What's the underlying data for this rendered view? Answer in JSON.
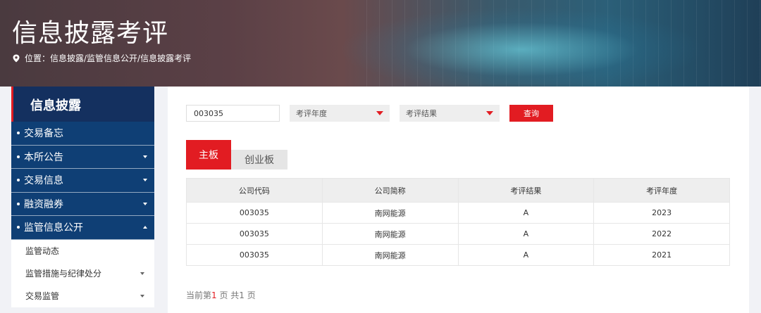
{
  "banner": {
    "title": "信息披露考评",
    "crumb": "位置：信息披露/监管信息公开/信息披露考评"
  },
  "sidebar": {
    "heading": "信息披露",
    "items": [
      {
        "label": "交易备忘"
      },
      {
        "label": "本所公告"
      },
      {
        "label": "交易信息"
      },
      {
        "label": "融资融券"
      },
      {
        "label": "监管信息公开"
      }
    ],
    "subitems": [
      {
        "label": "监管动态"
      },
      {
        "label": "监管措施与纪律处分"
      },
      {
        "label": "交易监管"
      }
    ]
  },
  "filters": {
    "code_value": "003035",
    "year_placeholder": "考评年度",
    "result_placeholder": "考评结果",
    "query_label": "查询"
  },
  "tabs": [
    {
      "label": "主板",
      "active": true
    },
    {
      "label": "创业板",
      "active": false
    }
  ],
  "table": {
    "headers": [
      "公司代码",
      "公司简称",
      "考评结果",
      "考评年度"
    ],
    "rows": [
      [
        "003035",
        "南网能源",
        "A",
        "2023"
      ],
      [
        "003035",
        "南网能源",
        "A",
        "2022"
      ],
      [
        "003035",
        "南网能源",
        "A",
        "2021"
      ]
    ]
  },
  "pager": {
    "prefix": "当前第",
    "current": "1",
    "mid": " 页   共",
    "total": "1",
    "suffix": " 页"
  },
  "colors": {
    "accent": "#e21c22",
    "nav": "#0f3f75",
    "nav_head": "#14305f"
  }
}
